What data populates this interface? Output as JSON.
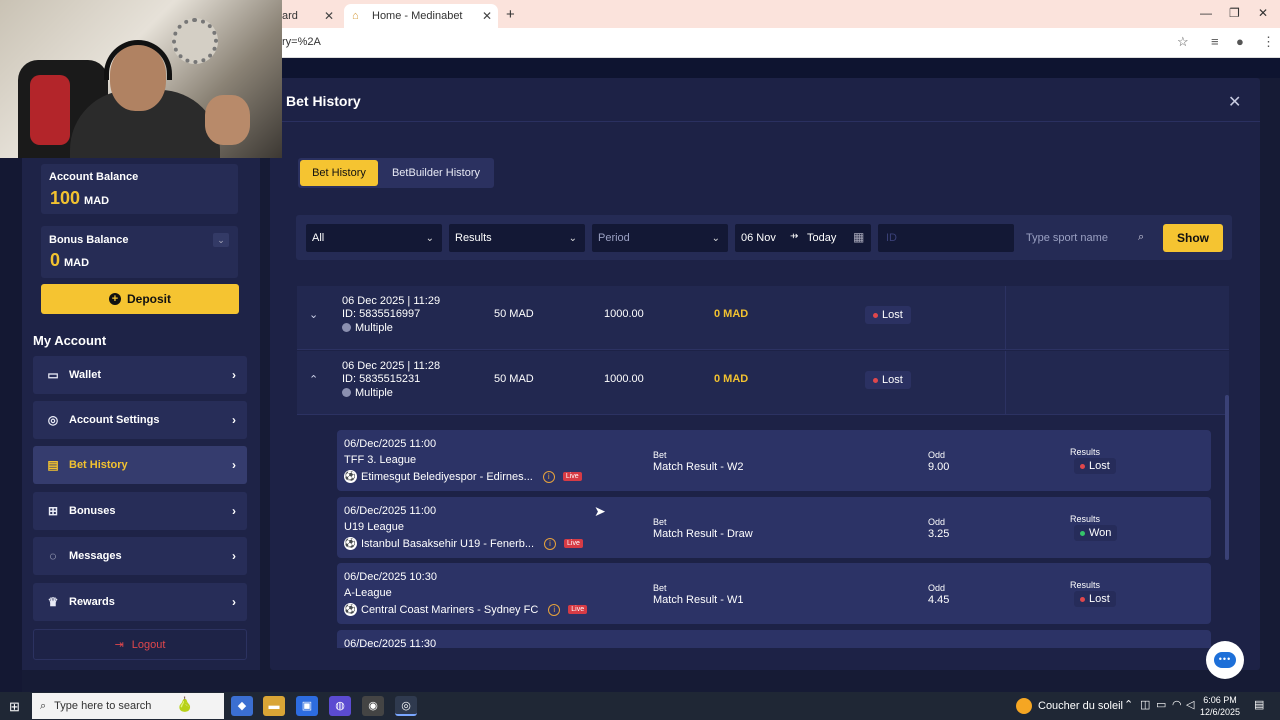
{
  "browser": {
    "tab_inactive_label": "ard",
    "tab_active_label": "Home - Medinabet",
    "address_text": "ry=%2A"
  },
  "account": {
    "balance_label": "Account Balance",
    "balance_value": "100",
    "balance_currency": "MAD",
    "bonus_label": "Bonus Balance",
    "bonus_value": "0",
    "bonus_currency": "MAD",
    "deposit_label": "Deposit"
  },
  "sidebar": {
    "section_title": "My Account",
    "items": [
      {
        "label": "Wallet",
        "icon": "wallet-icon"
      },
      {
        "label": "Account Settings",
        "icon": "user-settings-icon"
      },
      {
        "label": "Bet History",
        "icon": "history-icon",
        "active": true
      },
      {
        "label": "Bonuses",
        "icon": "gift-icon"
      },
      {
        "label": "Messages",
        "icon": "chat-icon"
      },
      {
        "label": "Rewards",
        "icon": "crown-icon"
      }
    ],
    "logout_label": "Logout"
  },
  "modal": {
    "title": "Bet History",
    "tabs": [
      {
        "label": "Bet History",
        "active": true
      },
      {
        "label": "BetBuilder History",
        "active": false
      }
    ],
    "filters": {
      "type": "All",
      "results": "Results",
      "period_placeholder": "Period",
      "date_from": "06 Nov",
      "date_to": "Today",
      "id_placeholder": "ID",
      "sport_placeholder": "Type sport name",
      "show_label": "Show"
    }
  },
  "bets": [
    {
      "datetime": "06 Dec 2025 | 11:29",
      "id": "ID: 5835516997",
      "type": "Multiple",
      "stake": "50 MAD",
      "odd": "1000.00",
      "win": "0 MAD",
      "status": "Lost",
      "expanded": false
    },
    {
      "datetime": "06 Dec 2025 | 11:28",
      "id": "ID: 5835515231",
      "type": "Multiple",
      "stake": "50 MAD",
      "odd": "1000.00",
      "win": "0 MAD",
      "status": "Lost",
      "expanded": true
    }
  ],
  "selections": [
    {
      "date": "06/Dec/2025 11:00",
      "league": "TFF 3. League",
      "match": "Etimesgut Belediyespor - Edirnes...",
      "live": "Live",
      "bet_label": "Bet",
      "bet": "Match Result - W2",
      "odd_label": "Odd",
      "odd": "9.00",
      "results_label": "Results",
      "result": "Lost"
    },
    {
      "date": "06/Dec/2025 11:00",
      "league": "U19 League",
      "match": "Istanbul Basaksehir U19 - Fenerb...",
      "live": "Live",
      "bet_label": "Bet",
      "bet": "Match Result - Draw",
      "odd_label": "Odd",
      "odd": "3.25",
      "results_label": "Results",
      "result": "Won"
    },
    {
      "date": "06/Dec/2025 10:30",
      "league": "A-League",
      "match": "Central Coast Mariners - Sydney FC",
      "live": "Live",
      "bet_label": "Bet",
      "bet": "Match Result - W1",
      "odd_label": "Odd",
      "odd": "4.45",
      "results_label": "Results",
      "result": "Lost"
    },
    {
      "date": "06/Dec/2025 11:30"
    }
  ],
  "colors": {
    "accent": "#f5c431",
    "lost": "#e0474c",
    "won": "#35c46a",
    "panel": "#1d2246"
  },
  "taskbar": {
    "search_placeholder": "Type here to search",
    "weather": "Coucher du soleil",
    "time": "6:06 PM",
    "date": "12/6/2025"
  }
}
